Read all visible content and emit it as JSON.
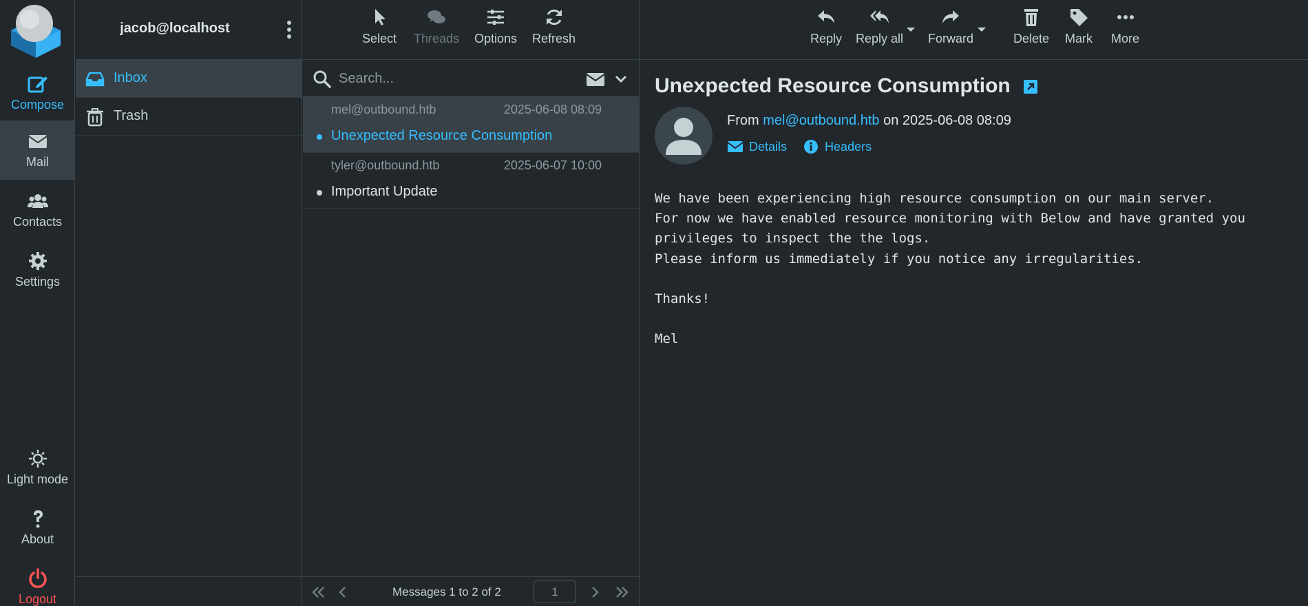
{
  "taskmenu": {
    "compose": "Compose",
    "mail": "Mail",
    "contacts": "Contacts",
    "settings": "Settings",
    "light_mode": "Light mode",
    "about": "About",
    "logout": "Logout"
  },
  "account": "jacob@localhost",
  "folders": [
    {
      "name": "Inbox",
      "icon": "inbox-icon"
    },
    {
      "name": "Trash",
      "icon": "trash-icon"
    }
  ],
  "list_toolbar": {
    "select": "Select",
    "threads": "Threads",
    "options": "Options",
    "refresh": "Refresh"
  },
  "search": {
    "placeholder": "Search..."
  },
  "messages": [
    {
      "from": "mel@outbound.htb",
      "date": "2025-06-08 08:09",
      "subject": "Unexpected Resource Consumption"
    },
    {
      "from": "tyler@outbound.htb",
      "date": "2025-06-07 10:00",
      "subject": "Important Update"
    }
  ],
  "pager": {
    "count": "Messages 1 to 2 of 2",
    "page": "1"
  },
  "content_toolbar": {
    "reply": "Reply",
    "reply_all": "Reply all",
    "forward": "Forward",
    "delete": "Delete",
    "mark": "Mark",
    "more": "More"
  },
  "message": {
    "subject": "Unexpected Resource Consumption",
    "from_prefix": "From",
    "from_email": "mel@outbound.htb",
    "on_word": "on",
    "date": "2025-06-08 08:09",
    "details": "Details",
    "headers": "Headers",
    "body": "We have been experiencing high resource consumption on our main server.\nFor now we have enabled resource monitoring with Below and have granted you\nprivileges to inspect the the logs.\nPlease inform us immediately if you notice any irregularities.\n\nThanks!\n\nMel"
  },
  "colors": {
    "accent": "#37beff",
    "logout": "#ff5552",
    "background": "#21272b",
    "selected": "#374147"
  }
}
